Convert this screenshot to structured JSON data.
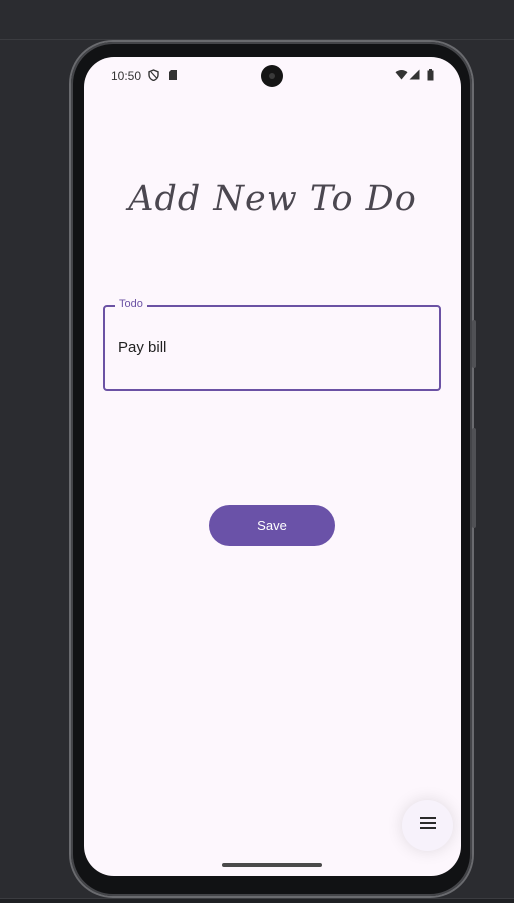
{
  "status_bar": {
    "time": "10:50",
    "left_icons": [
      "shield-icon",
      "sim-card-icon"
    ],
    "right_icons": [
      "wifi-icon",
      "signal-icon",
      "battery-icon"
    ]
  },
  "screen": {
    "title": "Add New To Do"
  },
  "todo_field": {
    "label": "Todo",
    "value": "Pay bill"
  },
  "save_button": {
    "label": "Save"
  },
  "fab": {
    "icon": "menu-icon"
  },
  "colors": {
    "accent": "#6a52a8",
    "screen_bg": "#fdf7fd",
    "title": "#4b4750"
  }
}
